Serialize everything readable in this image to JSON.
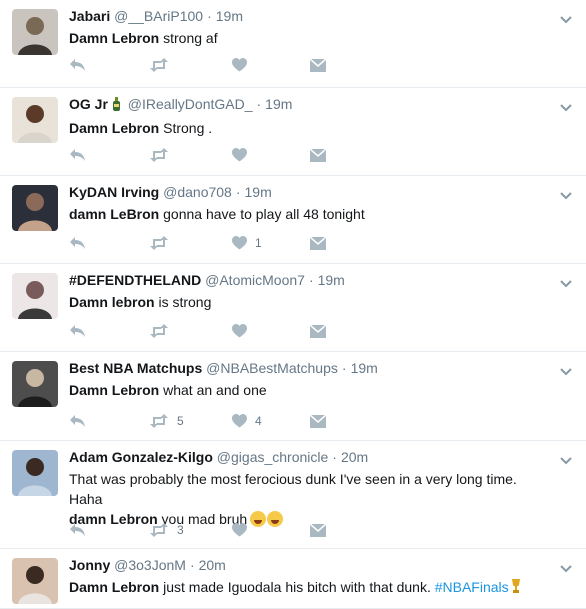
{
  "tweets": [
    {
      "name": "Jabari",
      "handle": "@__BAriP100",
      "time": "19m",
      "text_bold": "Damn Lebron",
      "text_rest": " strong af",
      "likes": "",
      "retweets": "",
      "avatar_colors": [
        "#c9c4bd",
        "#7a6a55",
        "#3a3530"
      ]
    },
    {
      "name": "OG Jr",
      "name_emoji": "bottle-icon",
      "handle": "@IReallyDontGAD_",
      "time": "19m",
      "text_bold": "Damn Lebron",
      "text_rest": " Strong .",
      "likes": "",
      "retweets": "",
      "avatar_colors": [
        "#e8e2d8",
        "#5b3a28",
        "#d9d4cc"
      ]
    },
    {
      "name": "KyDAN Irving",
      "handle": "@dano708",
      "time": "19m",
      "text_bold": "damn LeBron",
      "text_rest": " gonna have to play all 48 tonight",
      "likes": "1",
      "retweets": "",
      "avatar_colors": [
        "#2b2f3a",
        "#8c6a5a",
        "#c3a18a"
      ]
    },
    {
      "name": "#DEFENDTHELAND",
      "handle": "@AtomicMoon7",
      "time": "19m",
      "text_bold": "Damn lebron",
      "text_rest": " is strong",
      "likes": "",
      "retweets": "",
      "avatar_colors": [
        "#ece6e6",
        "#7a5b5b",
        "#3a3a3a"
      ]
    },
    {
      "name": "Best NBA Matchups",
      "handle": "@NBABestMatchups",
      "time": "19m",
      "text_bold": "Damn Lebron",
      "text_rest": " what an and one",
      "likes": "4",
      "retweets": "5",
      "avatar_colors": [
        "#4d4d4d",
        "#c7b7a3",
        "#1d1d1d"
      ]
    },
    {
      "name": "Adam Gonzalez-Kilgo",
      "handle": "@gigas_chronicle",
      "time": "20m",
      "text_line1": "That was probably the most ferocious dunk I've seen in a very long time. Haha",
      "text_bold": "damn Lebron",
      "text_rest": " you mad bruh",
      "likes": "",
      "retweets": "3",
      "avatar_colors": [
        "#9fb6d1",
        "#3a2a22",
        "#c7d6e6"
      ]
    },
    {
      "name": "Jonny",
      "handle": "@3o3JonM",
      "time": "20m",
      "text_bold": "Damn Lebron",
      "text_rest": " just made Iguodala his bitch with that dunk. ",
      "hashtag": "#NBAFinals",
      "likes": "",
      "retweets": "",
      "avatar_colors": [
        "#d9c3b0",
        "#3a2a22",
        "#e9e4df"
      ]
    }
  ],
  "separator": "·",
  "colors": {
    "name": "#14171a",
    "meta": "#657786",
    "icon": "#aab8c2",
    "hashtag": "#1b95e0",
    "border": "#e6ecf0"
  }
}
